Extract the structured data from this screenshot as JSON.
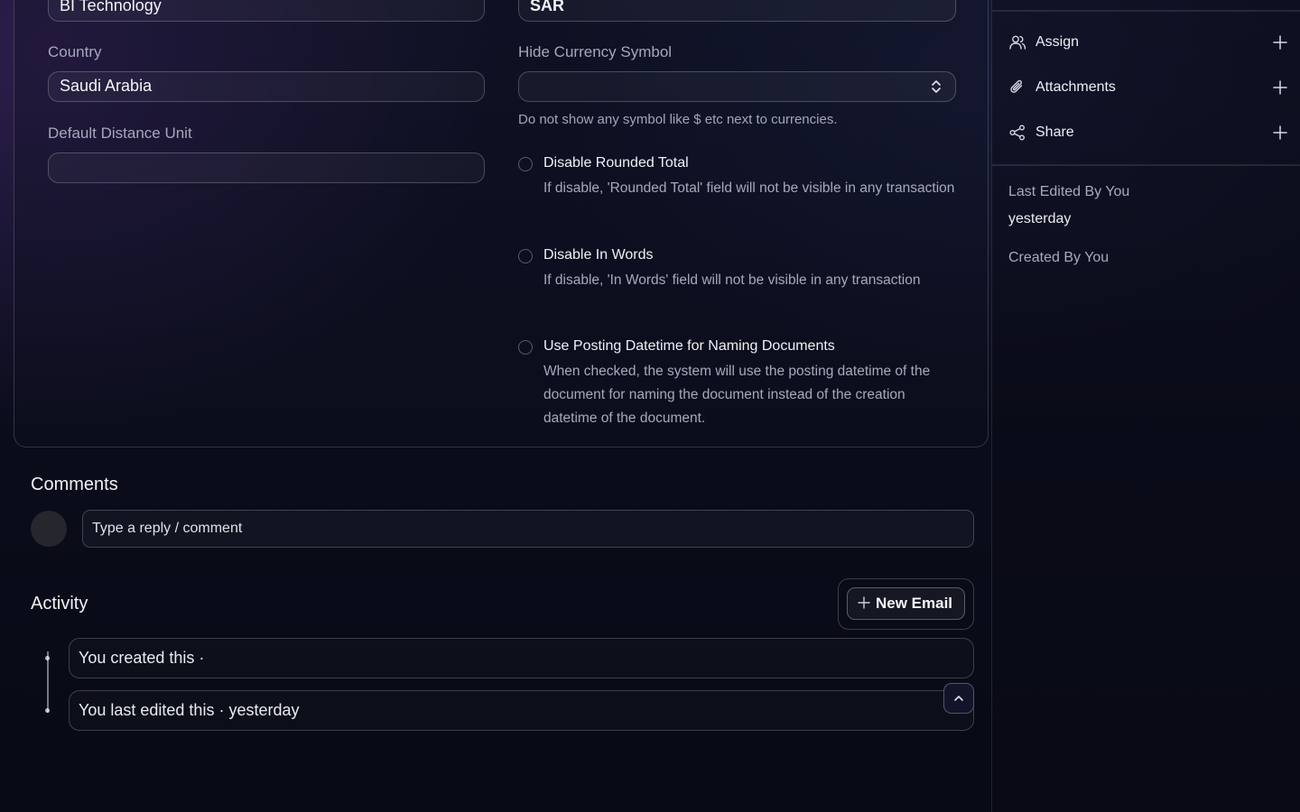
{
  "form": {
    "company_value": "BI Technology",
    "currency_value": "SAR",
    "country_label": "Country",
    "country_value": "Saudi Arabia",
    "hide_currency_label": "Hide Currency Symbol",
    "hide_currency_value": "",
    "hide_currency_help": "Do not show any symbol like $ etc next to currencies.",
    "distance_unit_label": "Default Distance Unit",
    "distance_unit_value": "",
    "checkboxes": [
      {
        "title": "Disable Rounded Total",
        "desc": "If disable, 'Rounded Total' field will not be visible in any transaction"
      },
      {
        "title": "Disable In Words",
        "desc": "If disable, 'In Words' field will not be visible in any transaction"
      },
      {
        "title": "Use Posting Datetime for Naming Documents",
        "desc": "When checked, the system will use the posting datetime of the document for naming the document instead of the creation datetime of the document."
      }
    ]
  },
  "comments": {
    "title": "Comments",
    "placeholder": "Type a reply / comment"
  },
  "activity": {
    "title": "Activity",
    "new_email_label": "New Email",
    "items": [
      "You created this ·",
      "You last edited this · yesterday"
    ]
  },
  "sidebar": {
    "items": [
      {
        "label": "Assign",
        "icon": "user-icon"
      },
      {
        "label": "Attachments",
        "icon": "paperclip-icon"
      },
      {
        "label": "Share",
        "icon": "share-icon"
      }
    ],
    "last_edited_label": "Last Edited By You",
    "last_edited_value": "yesterday",
    "created_label": "Created By You"
  },
  "colors": {
    "background": "#090b16",
    "border": "#ffffff33",
    "muted_text": "#a5a8ba"
  }
}
